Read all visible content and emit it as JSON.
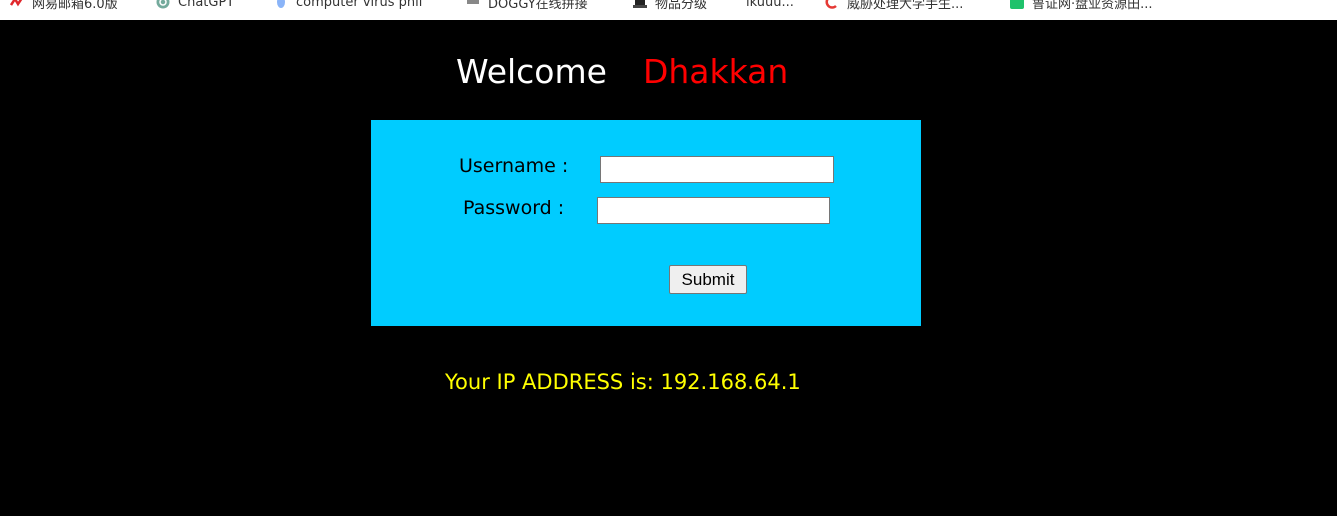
{
  "bookmarks": [
    {
      "label": "网易邮箱6.0版",
      "icon": "netease-mail-icon"
    },
    {
      "label": "ChatGPT",
      "icon": "chatgpt-icon"
    },
    {
      "label": "computer virus phil",
      "icon": "blue-dot-icon"
    },
    {
      "label": "DOGGY在线拼接",
      "icon": "doggy-icon"
    },
    {
      "label": "物品分级",
      "icon": "hat-icon"
    },
    {
      "label": "ikuuu...",
      "icon": "ikuuu-icon"
    },
    {
      "label": "威胁处理大学手生...",
      "icon": "red-c-icon"
    },
    {
      "label": "鲁证网·盘业资源田...",
      "icon": "green-square-icon"
    }
  ],
  "header": {
    "welcome": "Welcome",
    "name": "Dhakkan"
  },
  "form": {
    "username_label": "Username :",
    "password_label": "Password :",
    "username_value": "",
    "password_value": "",
    "submit_label": "Submit"
  },
  "ip_message": "Your IP ADDRESS is: 192.168.64.1",
  "colors": {
    "background": "#000000",
    "panel": "#00ccff",
    "welcome": "#ffffff",
    "name": "#ff0000",
    "ip_text": "#ffff00"
  }
}
